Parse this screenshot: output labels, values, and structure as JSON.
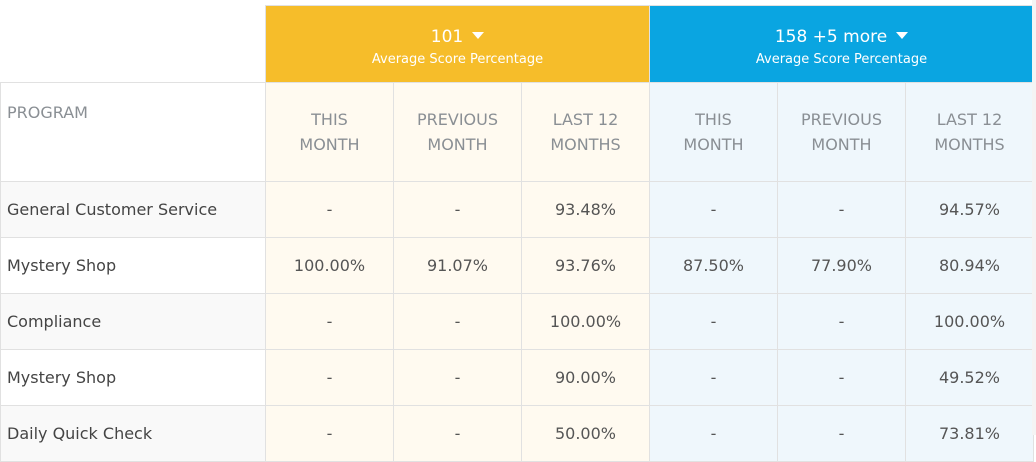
{
  "groups": [
    {
      "title": "101",
      "subtitle": "Average Score Percentage",
      "accent": "#f6bd2a"
    },
    {
      "title": "158 +5 more",
      "subtitle": "Average Score Percentage",
      "accent": "#0aa5e1"
    }
  ],
  "columns": {
    "program": "PROGRAM",
    "this_month": [
      "THIS",
      "MONTH"
    ],
    "previous_month": [
      "PREVIOUS",
      "MONTH"
    ],
    "last_12_months": [
      "LAST 12",
      "MONTHS"
    ]
  },
  "rows": [
    {
      "program": "General Customer Service",
      "g1": [
        "-",
        "-",
        "93.48%"
      ],
      "g2": [
        "-",
        "-",
        "94.57%"
      ]
    },
    {
      "program": "Mystery Shop",
      "g1": [
        "100.00%",
        "91.07%",
        "93.76%"
      ],
      "g2": [
        "87.50%",
        "77.90%",
        "80.94%"
      ]
    },
    {
      "program": "Compliance",
      "g1": [
        "-",
        "-",
        "100.00%"
      ],
      "g2": [
        "-",
        "-",
        "100.00%"
      ]
    },
    {
      "program": "Mystery Shop",
      "g1": [
        "-",
        "-",
        "90.00%"
      ],
      "g2": [
        "-",
        "-",
        "49.52%"
      ]
    },
    {
      "program": "Daily Quick Check",
      "g1": [
        "-",
        "-",
        "50.00%"
      ],
      "g2": [
        "-",
        "-",
        "73.81%"
      ]
    }
  ]
}
